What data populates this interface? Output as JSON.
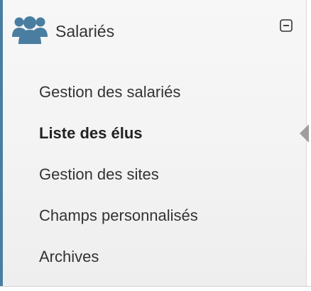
{
  "theme": {
    "accent": "#4a7ea1",
    "pointer": "#9e9e9e"
  },
  "header": {
    "icon": "users-icon",
    "title": "Salariés",
    "toggle_icon": "collapse-minus-icon"
  },
  "menu": {
    "items": [
      {
        "label": "Gestion des salariés",
        "active": false
      },
      {
        "label": "Liste des élus",
        "active": true
      },
      {
        "label": "Gestion des sites",
        "active": false
      },
      {
        "label": "Champs personnalisés",
        "active": false
      },
      {
        "label": "Archives",
        "active": false
      }
    ]
  }
}
